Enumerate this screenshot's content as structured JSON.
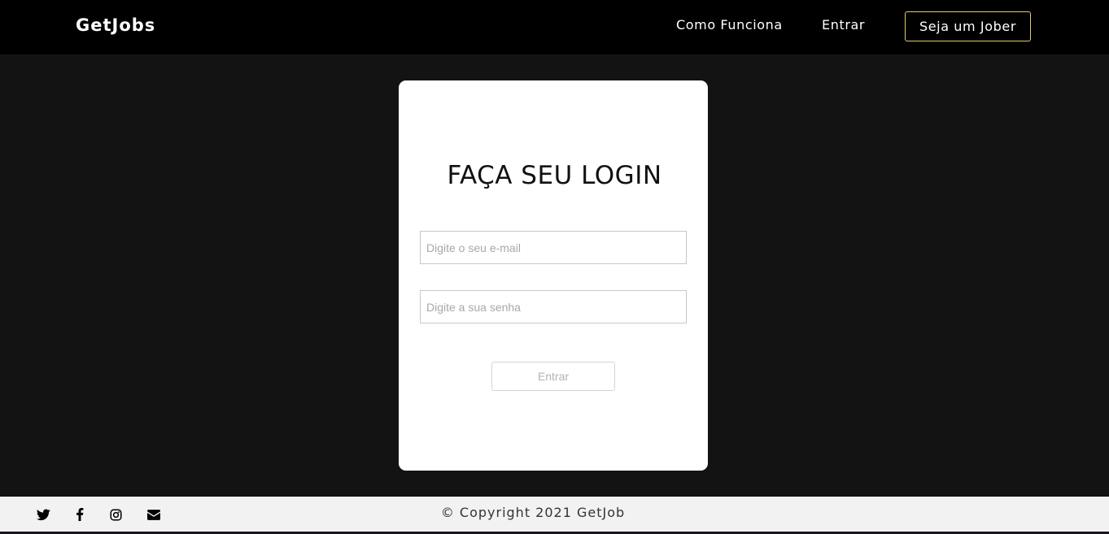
{
  "header": {
    "brand": "GetJobs",
    "nav": {
      "how_it_works": "Como Funciona",
      "login": "Entrar",
      "signup": "Seja um Jober"
    }
  },
  "login_form": {
    "title": "FAÇA SEU LOGIN",
    "email_placeholder": "Digite o seu e-mail",
    "password_placeholder": "Digite a sua senha",
    "submit_label": "Entrar"
  },
  "footer": {
    "copyright": "© Copyright 2021 GetJob",
    "social_icons": [
      "twitter-icon",
      "facebook-icon",
      "instagram-icon",
      "envelope-icon"
    ]
  },
  "colors": {
    "page_background": "#131313",
    "navbar_background": "#000000",
    "signup_border": "#e6c96b",
    "card_background": "#ffffff",
    "footer_background": "#f2f2f2"
  }
}
